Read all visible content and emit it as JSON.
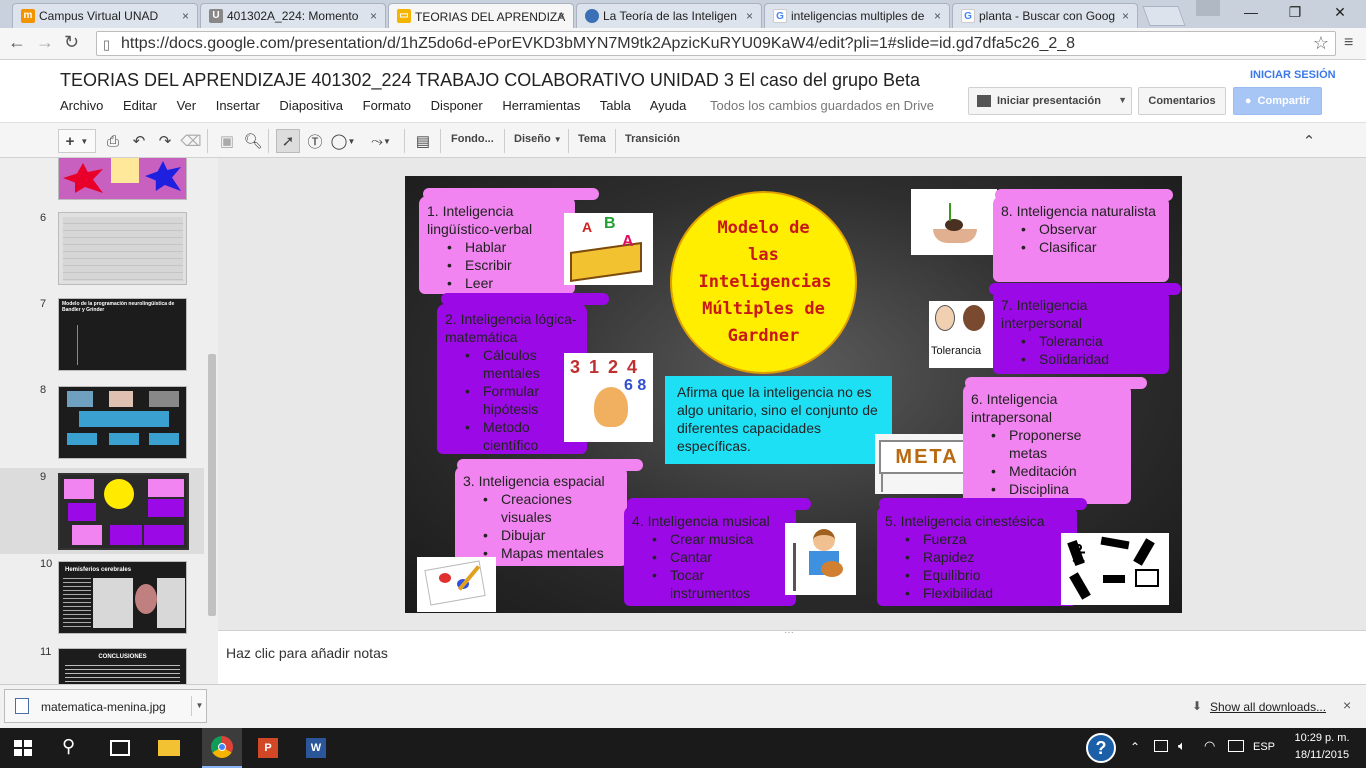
{
  "browser": {
    "tabs": [
      {
        "title": "Campus Virtual UNAD",
        "icon": "moodle-icon",
        "color": "#f29400"
      },
      {
        "title": "401302A_224: Momento",
        "icon": "unad-icon",
        "color": "#555555"
      },
      {
        "title": "TEORIAS DEL APRENDIZA",
        "icon": "slides-icon",
        "color": "#f4b400"
      },
      {
        "title": "La Teoría de las Inteligen",
        "icon": "globe-icon",
        "color": "#3b6fb6"
      },
      {
        "title": "inteligencias multiples de",
        "icon": "google-icon",
        "color": "#4285f4"
      },
      {
        "title": "planta - Buscar con Goog",
        "icon": "google-icon",
        "color": "#4285f4"
      }
    ],
    "close_glyph": "×",
    "url": "https://docs.google.com/presentation/d/1hZ5do6d-ePorEVKD3bMYN7M9tk2ApzicKuRYU09KaW4/edit?pli=1#slide=id.gd7dfa5c26_2_8"
  },
  "docs": {
    "title": "TEORIAS DEL APRENDIZAJE 401302_224 TRABAJO COLABORATIVO UNIDAD 3 El caso del grupo Beta",
    "menu": [
      "Archivo",
      "Editar",
      "Ver",
      "Insertar",
      "Diapositiva",
      "Formato",
      "Disponer",
      "Herramientas",
      "Tabla",
      "Ayuda"
    ],
    "save_status": "Todos los cambios guardados en Drive",
    "signin": "INICIAR SESIÓN",
    "present_label": "Iniciar presentación",
    "comments_label": "Comentarios",
    "share_label": "Compartir"
  },
  "toolbar": {
    "fondo": "Fondo...",
    "diseno": "Diseño",
    "tema": "Tema",
    "transicion": "Transición"
  },
  "filmstrip": {
    "numbers": [
      "6",
      "7",
      "8",
      "9",
      "10",
      "11"
    ],
    "slide7_text": "Modelo de la programación neurolingüística de Bandler y Grinder",
    "slide10_title": "Hemisferios cerebrales",
    "slide11_title": "CONCLUSIONES"
  },
  "slide": {
    "center_title": "Modelo de las Inteligencias Múltiples de Gardner",
    "info": "Afirma que la inteligencia no es algo unitario, sino el conjunto de diferentes capacidades específicas.",
    "meta_sign": "META",
    "scrolls": [
      {
        "title": "1. Inteligencia lingüístico-verbal",
        "items": [
          "Hablar",
          "Escribir",
          "Leer"
        ]
      },
      {
        "title": "2. Inteligencia lógica-matemática",
        "items": [
          "Cálculos mentales",
          "Formular hipótesis",
          "Metodo científico"
        ]
      },
      {
        "title": "3. Inteligencia espacial",
        "items": [
          "Creaciones visuales",
          "Dibujar",
          "Mapas mentales"
        ]
      },
      {
        "title": "4. Inteligencia musical",
        "items": [
          "Crear musica",
          "Cantar",
          "Tocar instrumentos"
        ]
      },
      {
        "title": "5. Inteligencia cinestésica",
        "items": [
          "Fuerza",
          "Rapidez",
          "Equilibrio",
          "Flexibilidad"
        ]
      },
      {
        "title": "6. Inteligencia intrapersonal",
        "items": [
          "Proponerse metas",
          "Meditación",
          "Disciplina"
        ]
      },
      {
        "title": "7. Inteligencia interpersonal",
        "items": [
          "Tolerancia",
          "Solidaridad"
        ]
      },
      {
        "title": "8. Inteligencia naturalista",
        "items": [
          "Observar",
          "Clasificar"
        ]
      }
    ],
    "tolerancia_word": "Tolerancia"
  },
  "notes": {
    "placeholder": "Haz clic para añadir notas"
  },
  "downloads": {
    "file": "matematica-menina.jpg",
    "show_all": "Show all downloads...",
    "close_glyph": "×"
  },
  "taskbar": {
    "lang": "ESP",
    "time": "10:29 p. m.",
    "date": "18/11/2015",
    "help_glyph": "?"
  }
}
